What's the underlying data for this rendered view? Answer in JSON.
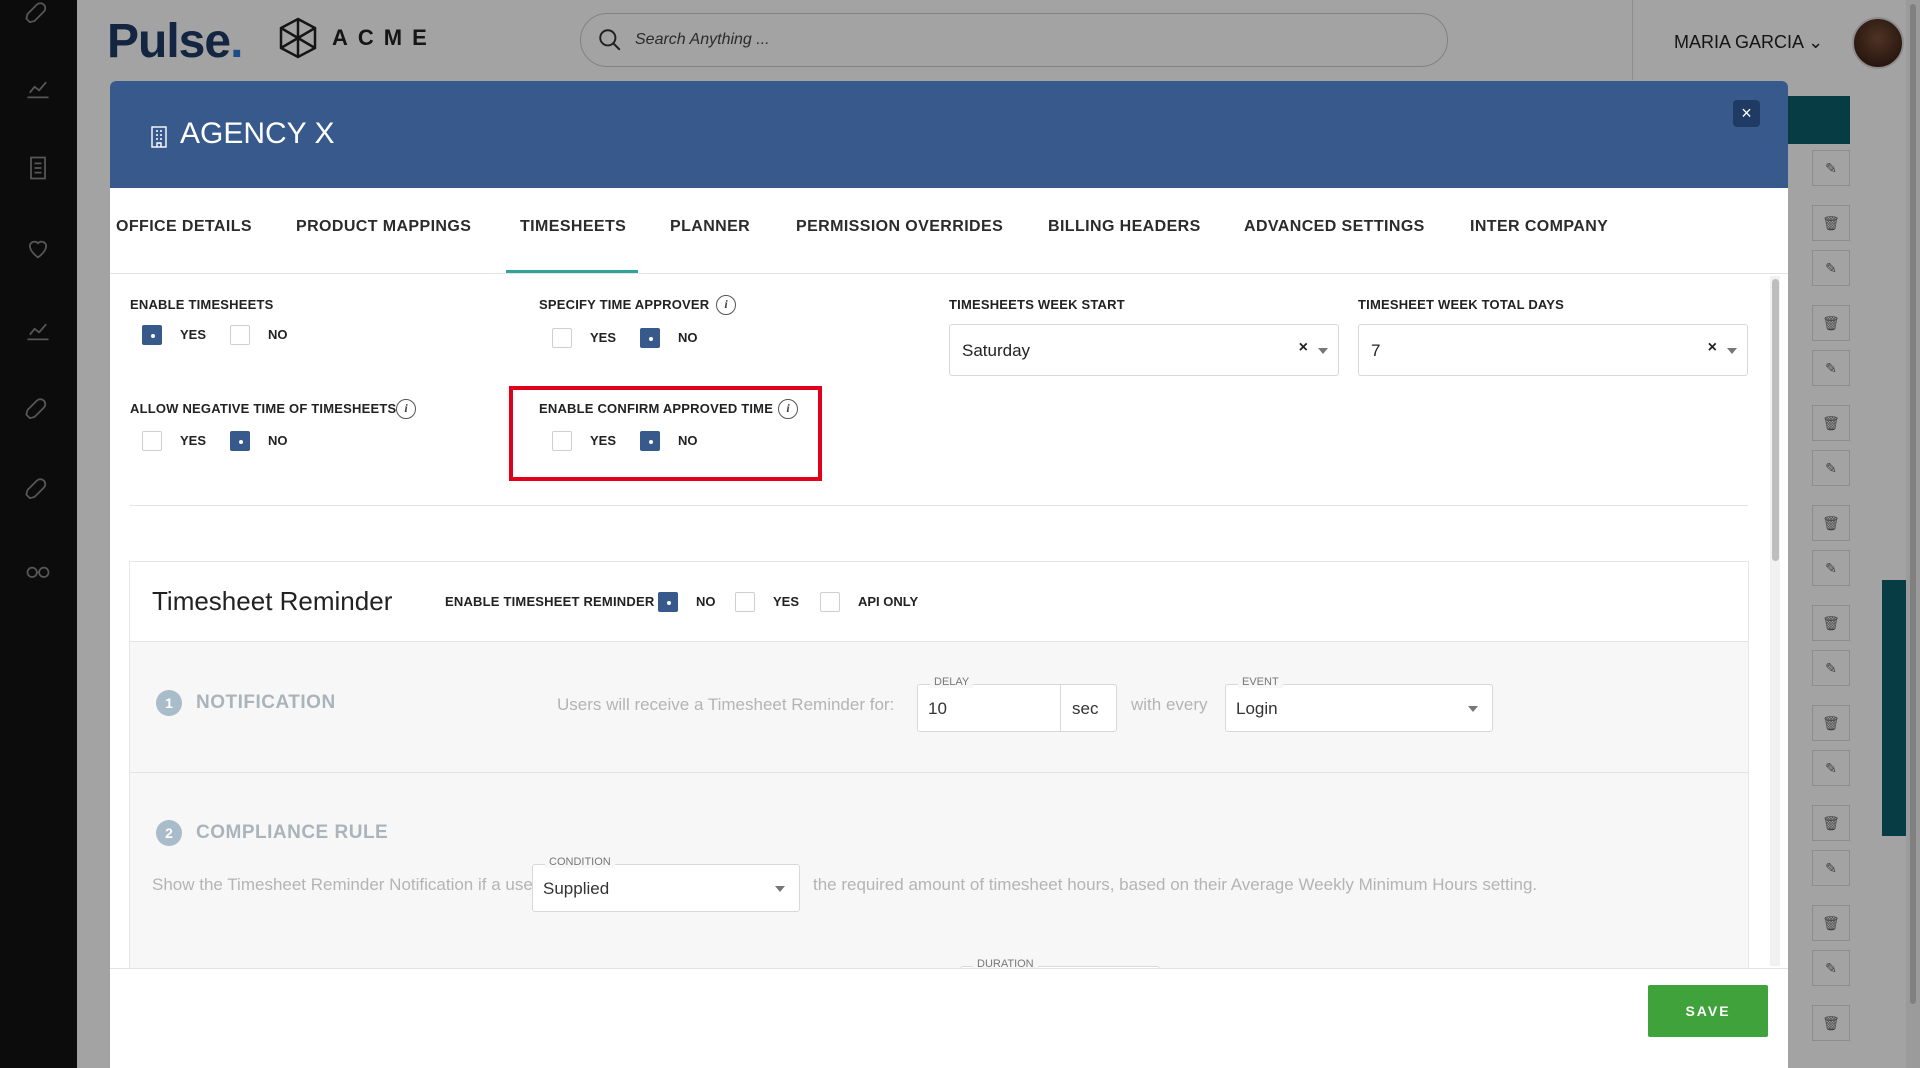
{
  "app": {
    "brand": "Pulse",
    "brand_dot": ".",
    "client_brand": "ACME",
    "search_placeholder": "Search Anything ...",
    "user_name": "MARIA GARCIA"
  },
  "modal": {
    "title": "AGENCY X",
    "close_label": "×",
    "tabs": [
      {
        "label": "OFFICE DETAILS"
      },
      {
        "label": "PRODUCT MAPPINGS"
      },
      {
        "label": "TIMESHEETS"
      },
      {
        "label": "PLANNER"
      },
      {
        "label": "PERMISSION OVERRIDES"
      },
      {
        "label": "BILLING HEADERS"
      },
      {
        "label": "ADVANCED SETTINGS"
      },
      {
        "label": "INTER COMPANY"
      }
    ],
    "active_tab": "TIMESHEETS"
  },
  "settings": {
    "enable_timesheets": {
      "label": "ENABLE TIMESHEETS",
      "yes": "YES",
      "no": "NO",
      "selected": "YES"
    },
    "specify_time_approver": {
      "label": "SPECIFY TIME APPROVER",
      "yes": "YES",
      "no": "NO",
      "selected": "NO"
    },
    "allow_negative_time": {
      "label": "ALLOW NEGATIVE TIME OF TIMESHEETS",
      "yes": "YES",
      "no": "NO",
      "selected": "NO"
    },
    "enable_confirm_approved_time": {
      "label": "ENABLE CONFIRM APPROVED TIME",
      "yes": "YES",
      "no": "NO",
      "selected": "NO"
    },
    "week_start": {
      "label": "TIMESHEETS WEEK START",
      "value": "Saturday",
      "clear": "×"
    },
    "week_total_days": {
      "label": "TIMESHEET WEEK TOTAL DAYS",
      "value": "7",
      "clear": "×"
    },
    "info_glyph": "i"
  },
  "reminder": {
    "title": "Timesheet Reminder",
    "enable_label": "ENABLE TIMESHEET REMINDER",
    "options": {
      "no": "NO",
      "yes": "YES",
      "api_only": "API ONLY"
    },
    "selected": "NO",
    "notification": {
      "step": "1",
      "title": "NOTIFICATION",
      "prefix": "Users will receive a Timesheet Reminder for:",
      "delay_label": "DELAY",
      "delay_value": "10",
      "delay_unit": "sec",
      "with_every": "with every",
      "event_label": "EVENT",
      "event_value": "Login"
    },
    "compliance": {
      "step": "2",
      "title": "COMPLIANCE RULE",
      "prefix": "Show the Timesheet Reminder Notification if a user has not",
      "condition_label": "CONDITION",
      "condition_value": "Supplied",
      "suffix": "the required amount of timesheet hours, based on their Average Weekly Minimum Hours setting.",
      "duration_label": "DURATION"
    }
  },
  "footer": {
    "save_label": "SAVE"
  },
  "colors": {
    "header_blue": "#38598b",
    "tab_accent": "#2ea39a",
    "save_green": "#3fa23a",
    "highlight_red": "#e0001b"
  }
}
